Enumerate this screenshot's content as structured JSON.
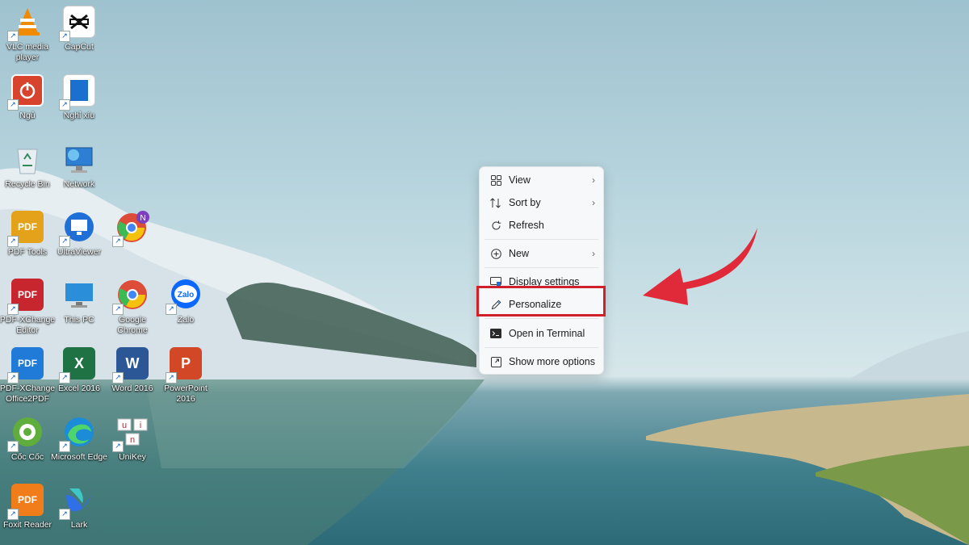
{
  "desktop_icons": [
    {
      "label": "VLC media player",
      "icon": "vlc-icon",
      "color": "#f08a00"
    },
    {
      "label": "CapCut",
      "icon": "capcut-icon",
      "color": "#111111"
    },
    {
      "label": "Ngủ",
      "icon": "power-icon",
      "color": "#d8432e"
    },
    {
      "label": "Nghỉ xíu",
      "icon": "window-icon",
      "color": "#1b6fcf"
    },
    {
      "label": "Recycle Bin",
      "icon": "recycle-bin-icon",
      "color": "#cfd8de"
    },
    {
      "label": "Network",
      "icon": "network-icon",
      "color": "#2d7fd3"
    },
    {
      "label": "PDF Tools",
      "icon": "pdf-tools-icon",
      "color": "#e3a21a"
    },
    {
      "label": "UltraViewer",
      "icon": "ultraviewer-icon",
      "color": "#1f6fd6"
    },
    {
      "label": "",
      "icon": "chrome-profile-icon",
      "color": "#7b3fbf"
    },
    {
      "label": "PDF-XChange Editor",
      "icon": "pdf-xchange-editor-icon",
      "color": "#c8262e"
    },
    {
      "label": "This PC",
      "icon": "this-pc-icon",
      "color": "#2a8fd8"
    },
    {
      "label": "Google Chrome",
      "icon": "chrome-icon",
      "color": "#dd4b39"
    },
    {
      "label": "Zalo",
      "icon": "zalo-icon",
      "color": "#0a68ff"
    },
    {
      "label": "PDF-XChange Office2PDF",
      "icon": "office2pdf-icon",
      "color": "#1f7ad8"
    },
    {
      "label": "Excel 2016",
      "icon": "excel-icon",
      "color": "#1f7244"
    },
    {
      "label": "Word 2016",
      "icon": "word-icon",
      "color": "#2b5797"
    },
    {
      "label": "PowerPoint 2016",
      "icon": "powerpoint-icon",
      "color": "#d24726"
    },
    {
      "label": "Cốc Cốc",
      "icon": "coccoc-icon",
      "color": "#5fae3b"
    },
    {
      "label": "Microsoft Edge",
      "icon": "edge-icon",
      "color": "#1c8bd8"
    },
    {
      "label": "UniKey",
      "icon": "unikey-icon",
      "color": "#ffffff"
    },
    {
      "label": "Foxit Reader",
      "icon": "foxit-icon",
      "color": "#f07d1a"
    },
    {
      "label": "Lark",
      "icon": "lark-icon",
      "color": "#2f6fe8"
    }
  ],
  "glyph_text": {
    "pdf": "PDF",
    "zalo": "Zalo",
    "excel": "X",
    "word": "W",
    "powerpoint": "P",
    "unikey": [
      "u",
      "i",
      "n"
    ],
    "chrome_badge": "N"
  },
  "context_menu": {
    "items": [
      {
        "label": "View",
        "icon": "grid-icon",
        "submenu": true
      },
      {
        "label": "Sort by",
        "icon": "sort-icon",
        "submenu": true
      },
      {
        "label": "Refresh",
        "icon": "refresh-icon",
        "submenu": false
      },
      {
        "label": "New",
        "icon": "plus-circle-icon",
        "submenu": true
      },
      {
        "label": "Display settings",
        "icon": "display-icon",
        "submenu": false
      },
      {
        "label": "Personalize",
        "icon": "pencil-icon",
        "submenu": false
      },
      {
        "label": "Open in Terminal",
        "icon": "terminal-icon",
        "submenu": false
      },
      {
        "label": "Show more options",
        "icon": "expand-icon",
        "submenu": false
      }
    ],
    "submenu_glyph": "›"
  },
  "annotation": {
    "highlighted_item": "Personalize",
    "highlight_color": "#d0202c",
    "arrow_color": "#e02a3a"
  }
}
